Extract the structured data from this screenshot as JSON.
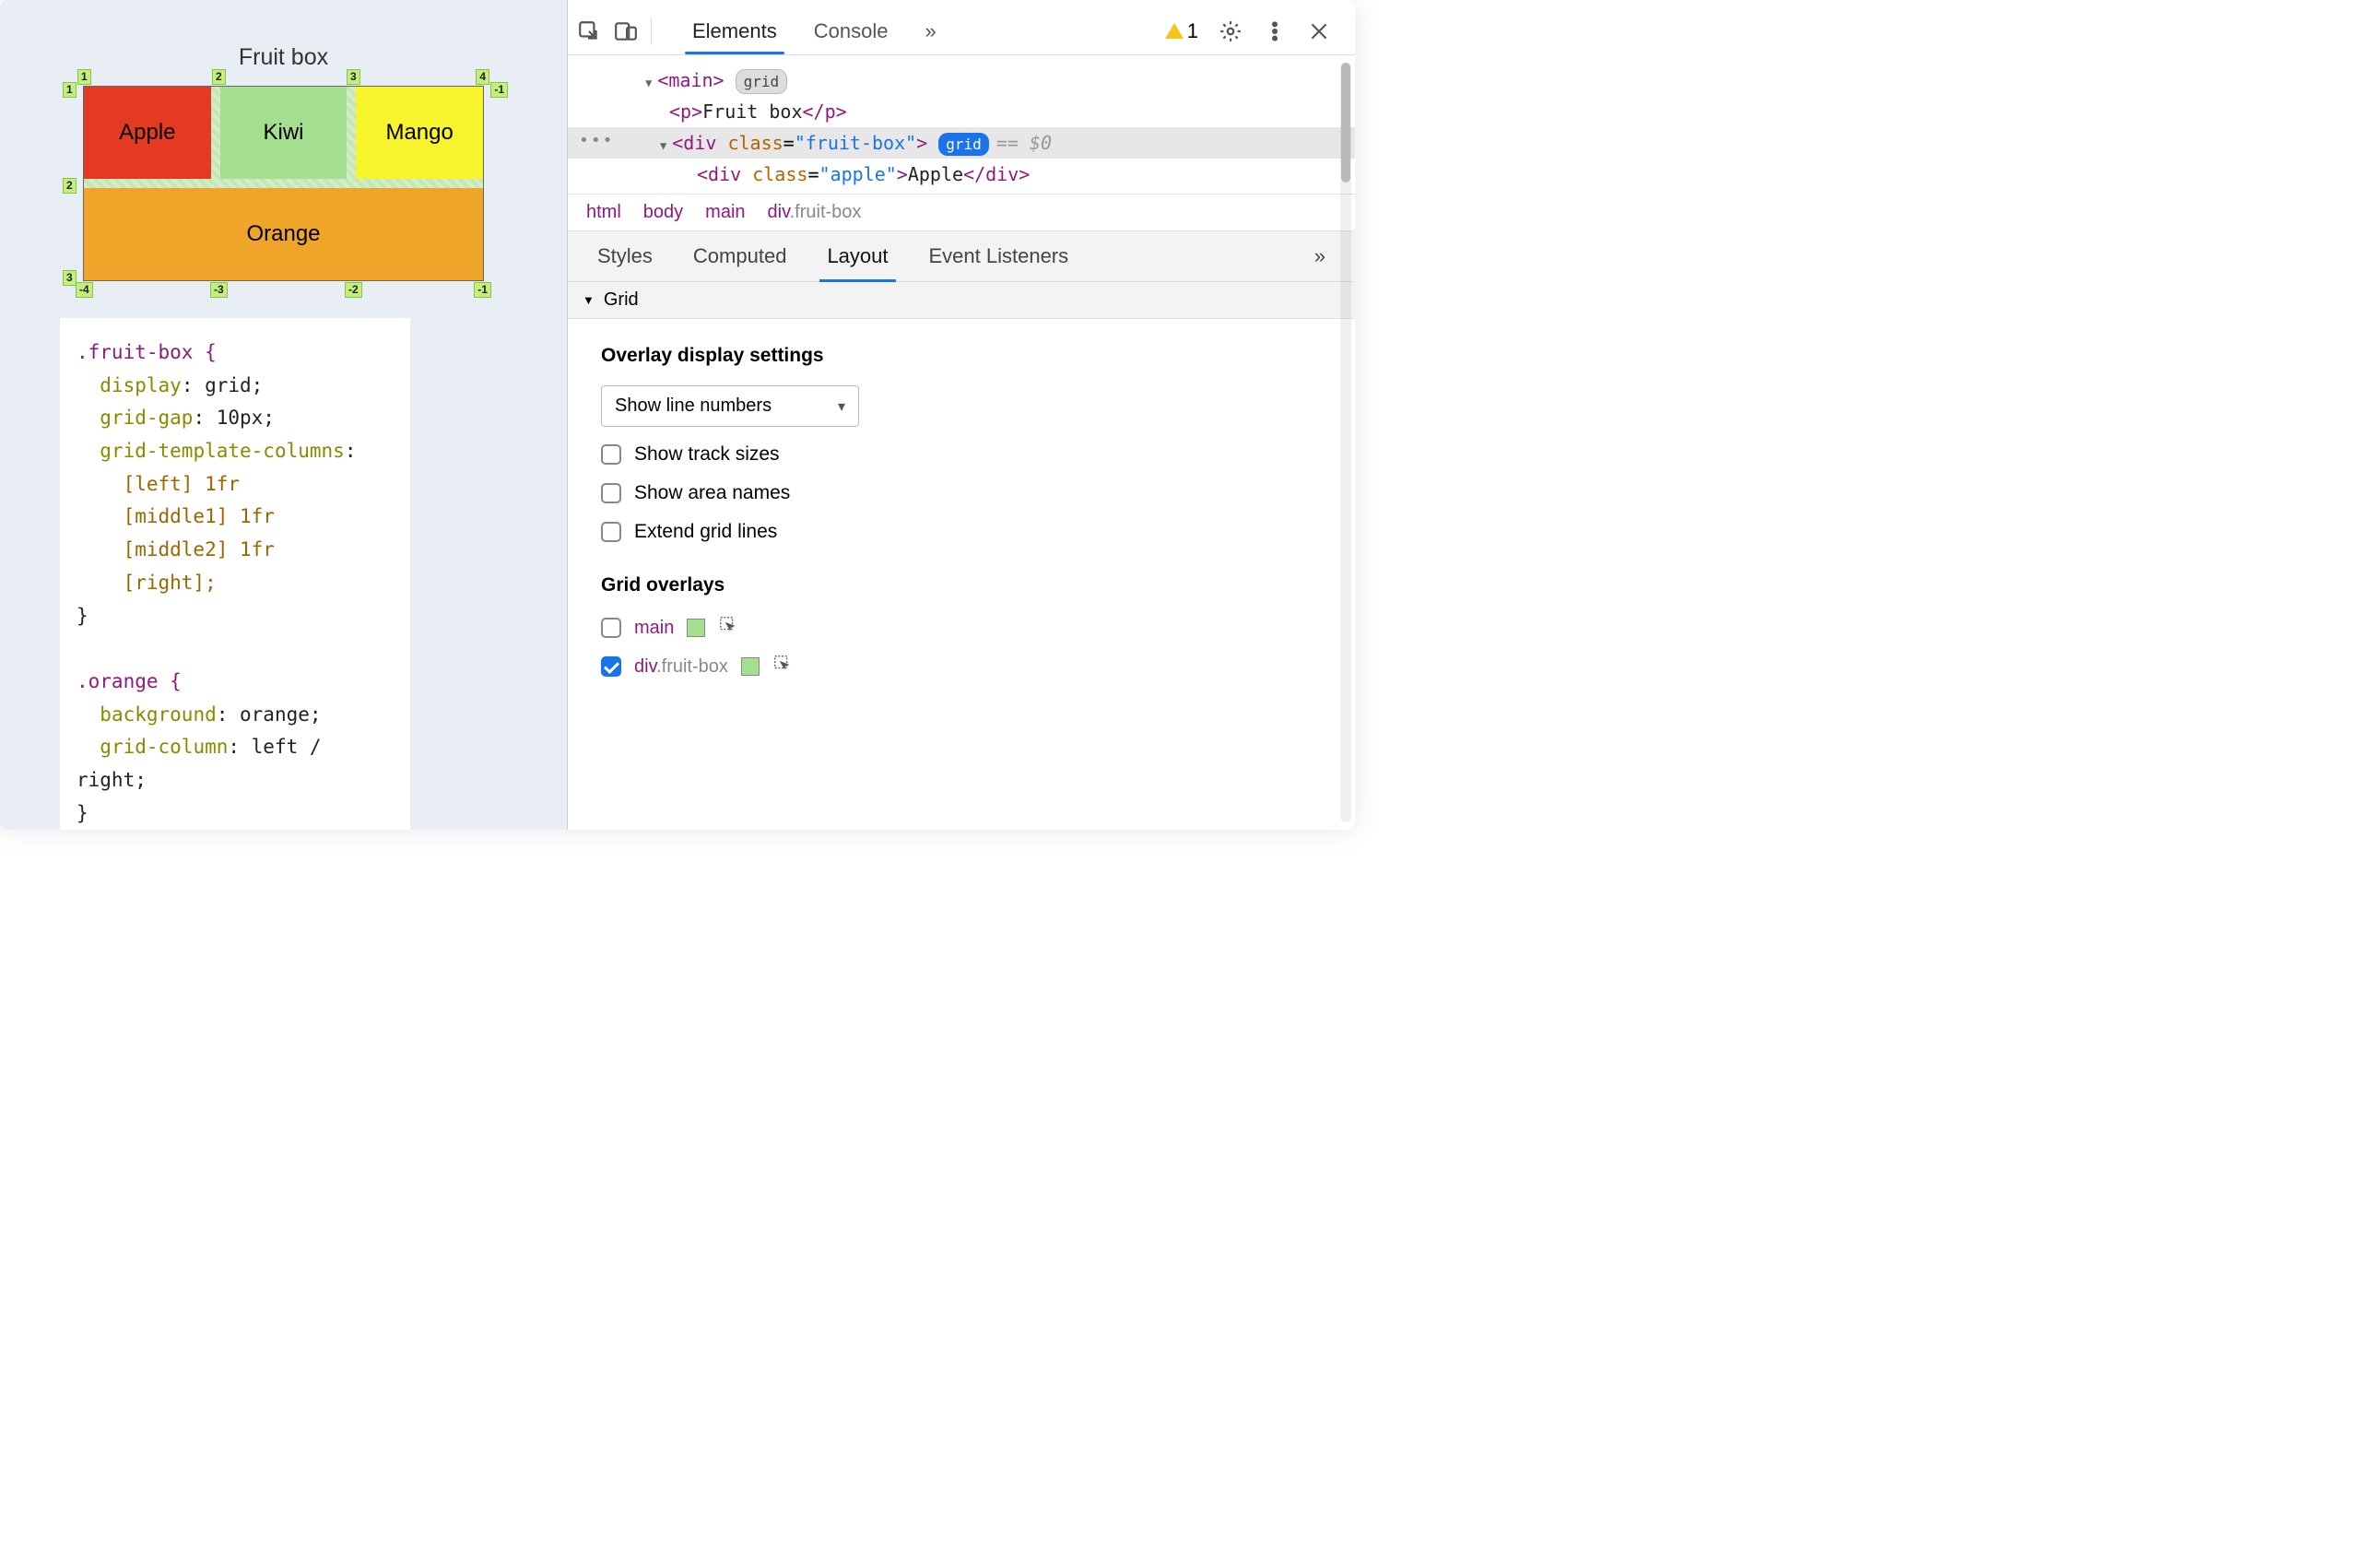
{
  "preview": {
    "title": "Fruit box",
    "cells": {
      "apple": "Apple",
      "kiwi": "Kiwi",
      "mango": "Mango",
      "orange": "Orange"
    },
    "labels": {
      "top": [
        "1",
        "2",
        "3",
        "4"
      ],
      "left": [
        "1",
        "2",
        "3"
      ],
      "bottom": [
        "-4",
        "-3",
        "-2",
        "-1"
      ],
      "right_top": "-1"
    },
    "code": {
      "rule1_sel": ".fruit-box {",
      "r1_l1_p": "display",
      "r1_l1_v": ": grid;",
      "r1_l2_p": "grid-gap",
      "r1_l2_v": ": 10px;",
      "r1_l3_p": "grid-template-columns",
      "r1_l3_v": ":",
      "r1_l4": "[left] 1fr",
      "r1_l5": "[middle1] 1fr",
      "r1_l6": "[middle2] 1fr",
      "r1_l7": "[right];",
      "close": "}",
      "rule2_sel": ".orange {",
      "r2_l1_p": "background",
      "r2_l1_v": ": orange;",
      "r2_l2_p": "grid-column",
      "r2_l2_v": ": left / right;"
    }
  },
  "devtools": {
    "tabs": {
      "elements": "Elements",
      "console": "Console",
      "more": "»"
    },
    "warning_count": "1",
    "dom": {
      "l1_open": "<main>",
      "l1_badge": "grid",
      "l2": "<p>Fruit box</p>",
      "l3_open": "<div class=\"fruit-box\">",
      "l3_badge": "grid",
      "l3_suffix": "== $0",
      "l4": "<div class=\"apple\">Apple</div>"
    },
    "crumbs": [
      "html",
      "body",
      "main",
      "div.fruit-box"
    ],
    "subtabs": {
      "styles": "Styles",
      "computed": "Computed",
      "layout": "Layout",
      "listeners": "Event Listeners",
      "more": "»"
    },
    "section_title": "Grid",
    "overlay_settings": {
      "heading": "Overlay display settings",
      "select": "Show line numbers",
      "opts": [
        "Show track sizes",
        "Show area names",
        "Extend grid lines"
      ]
    },
    "grid_overlays": {
      "heading": "Grid overlays",
      "rows": [
        {
          "checked": false,
          "name": "main"
        },
        {
          "checked": true,
          "name": "div",
          "rest": ".fruit-box"
        }
      ]
    }
  }
}
